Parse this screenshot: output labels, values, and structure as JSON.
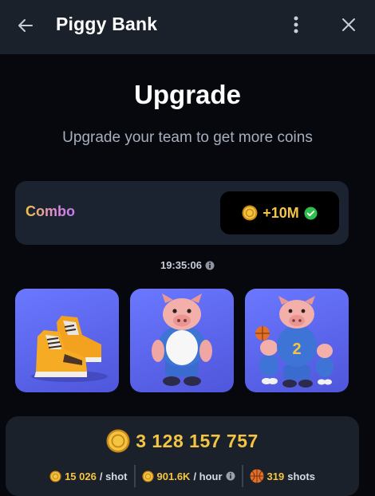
{
  "header": {
    "title": "Piggy Bank",
    "back_icon": "arrow-left-icon",
    "menu_icon": "more-vertical-icon",
    "close_icon": "close-icon"
  },
  "page": {
    "title": "Upgrade",
    "subtitle": "Upgrade your team to get more coins"
  },
  "combo": {
    "label": "Combo",
    "reward": "+10M",
    "reward_icon": "coin-icon",
    "status_icon": "check-circle-icon"
  },
  "timer": {
    "value": "19:35:06",
    "info_icon": "info-icon"
  },
  "cards": [
    {
      "name": "sneakers-card",
      "image": "sneakers-image"
    },
    {
      "name": "pig-card",
      "image": "pig-character-image"
    },
    {
      "name": "pig-team-card",
      "image": "pig-basketball-team-image"
    }
  ],
  "stats": {
    "balance": "3 128 157 757",
    "per_shot_value": "15 026",
    "per_shot_unit": "/ shot",
    "per_hour_value": "901.6K",
    "per_hour_unit": "/ hour",
    "shots_value": "319",
    "shots_unit": "shots"
  },
  "colors": {
    "accent_gold": "#f4c542",
    "card_blue": "#5b64ee",
    "panel": "#1b212b",
    "background": "#06080d",
    "success": "#2fbf4c"
  }
}
